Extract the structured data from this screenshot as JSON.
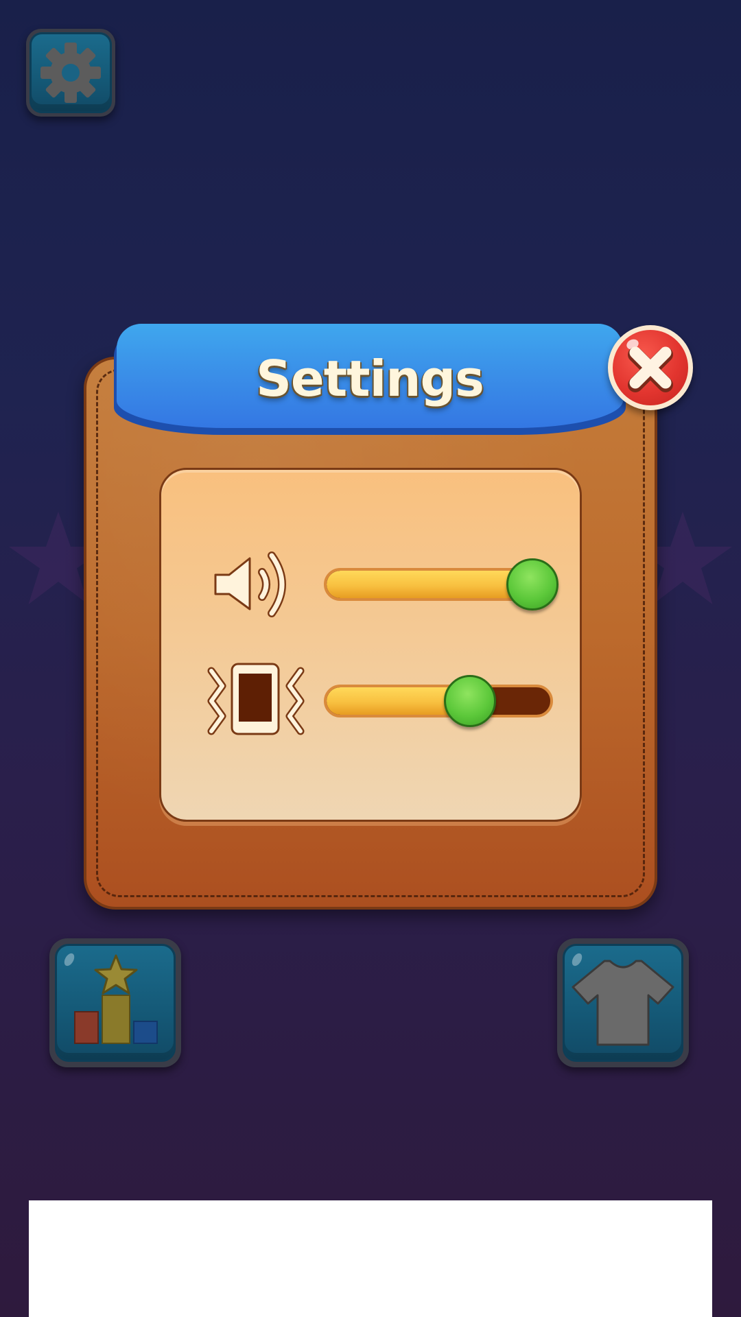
{
  "dialog": {
    "title": "Settings",
    "close_icon": "close-x-icon"
  },
  "top_bar": {
    "settings_icon": "gear-icon"
  },
  "controls": {
    "sound": {
      "icon": "speaker-icon",
      "level": 0.92
    },
    "vibration": {
      "icon": "vibration-phone-icon",
      "level": 0.64
    }
  },
  "bottom_bar": {
    "leaderboard_icon": "podium-star-icon",
    "shop_icon": "tshirt-icon"
  },
  "colors": {
    "background_top": "#19204a",
    "background_bottom": "#2e1a3d",
    "panel_leather": "#bc6a2c",
    "header_blue": "#3a8ee8",
    "close_red": "#e2352f",
    "slider_fill": "#f8c040",
    "slider_knob": "#5cc83a"
  }
}
